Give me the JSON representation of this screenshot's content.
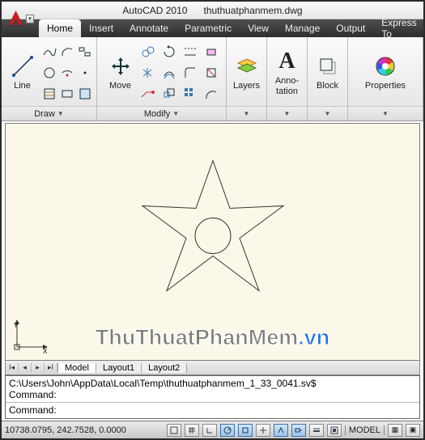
{
  "title": {
    "app": "AutoCAD 2010",
    "file": "thuthuatphanmem.dwg"
  },
  "tabs": [
    "Home",
    "Insert",
    "Annotate",
    "Parametric",
    "View",
    "Manage",
    "Output",
    "Express To"
  ],
  "active_tab": 0,
  "panels": {
    "draw": {
      "label": "Draw",
      "big": "Line",
      "grid": [
        "polyline",
        "arc-shape",
        "fillet",
        "spline",
        "circle",
        "ellipse-arc",
        "dot",
        "hatch",
        "rectangle",
        "grad",
        "spiral"
      ]
    },
    "modify": {
      "label": "Modify",
      "big": "Move",
      "grid": [
        "move-4",
        "rotate",
        "trim",
        "offset",
        "copy",
        "mirror",
        "chamfer",
        "array",
        "stretch",
        "scale",
        "grid3",
        "arc-seg"
      ]
    },
    "layers": {
      "label": "Layers",
      "big": "Layers"
    },
    "anno": {
      "label": "Anno-\ntation",
      "big": "A"
    },
    "block": {
      "label": "Block",
      "big": "Block"
    },
    "props": {
      "label": "Properties",
      "big": "Properties"
    }
  },
  "model_tabs": {
    "items": [
      "Model",
      "Layout1",
      "Layout2"
    ],
    "active": 0
  },
  "command": {
    "line1": "C:\\Users\\John\\AppData\\Local\\Temp\\thuthuatphanmem_1_33_0041.sv$",
    "line2": "Command:",
    "prompt": "Command:"
  },
  "status": {
    "coords": "10738.0795, 242.7528, 0.0000",
    "model": "MODEL",
    "toggles": [
      "snap",
      "grid",
      "ortho",
      "polar",
      "osnap",
      "otrack",
      "ducs",
      "dyn",
      "lw",
      "qprops"
    ]
  },
  "watermark": {
    "a": "ThuThuatPhanMem",
    "b": ".vn"
  }
}
